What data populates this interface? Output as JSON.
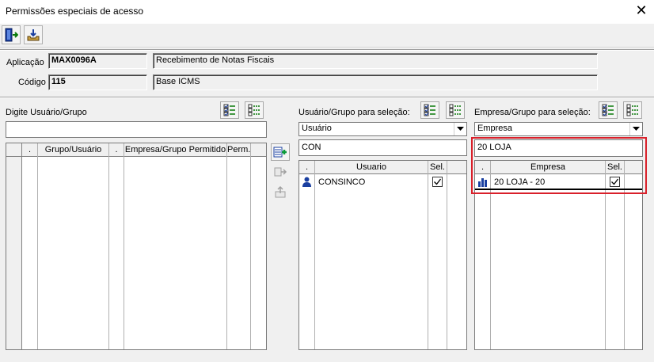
{
  "window": {
    "title": "Permissões especiais de acesso",
    "close_glyph": "✕"
  },
  "toolbar": {
    "buttons": [
      {
        "name": "exit-door-icon"
      },
      {
        "name": "save-tray-icon"
      }
    ]
  },
  "form": {
    "aplicacao_label": "Aplicação",
    "aplicacao_code": "MAX0096A",
    "aplicacao_desc": "Recebimento de Notas Fiscais",
    "codigo_label": "Código",
    "codigo_value": "115",
    "codigo_desc": "Base ICMS"
  },
  "left_panel": {
    "label": "Digite Usuário/Grupo",
    "input_value": "",
    "columns": [
      ".",
      "Grupo/Usuário",
      ".",
      "Empresa/Grupo Permitido",
      "Perm."
    ]
  },
  "middle_panel": {
    "label": "Usuário/Grupo para seleção:",
    "combo_value": "Usuário",
    "filter_value": "CON",
    "columns": [
      ".",
      "Usuario",
      "Sel."
    ],
    "rows": [
      {
        "icon": "user-icon",
        "name": "CONSINCO",
        "selected": true
      }
    ]
  },
  "right_panel": {
    "label": "Empresa/Grupo para seleção:",
    "combo_value": "Empresa",
    "filter_value": "20 LOJA",
    "columns": [
      ".",
      "Empresa",
      "Sel."
    ],
    "rows": [
      {
        "icon": "building-icon",
        "name": "20 LOJA - 20",
        "selected": true
      }
    ],
    "highlight_color": "#d9202a"
  }
}
